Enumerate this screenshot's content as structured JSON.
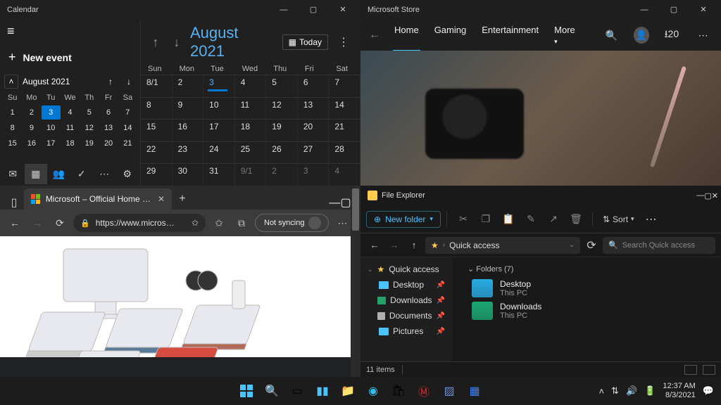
{
  "calendar": {
    "title": "Calendar",
    "new_event": "New event",
    "mini_month": "August 2021",
    "mini_days": [
      "Su",
      "Mo",
      "Tu",
      "We",
      "Th",
      "Fr",
      "Sa"
    ],
    "mini_cells": [
      "1",
      "2",
      "3",
      "4",
      "5",
      "6",
      "7",
      "8",
      "9",
      "10",
      "11",
      "12",
      "13",
      "14",
      "15",
      "16",
      "17",
      "18",
      "19",
      "20",
      "21"
    ],
    "mini_selected_index": 2,
    "big_month": "August 2021",
    "today_label": "Today",
    "big_days": [
      "Sun",
      "Mon",
      "Tue",
      "Wed",
      "Thu",
      "Fri",
      "Sat"
    ],
    "big_cells": [
      {
        "t": "8/1"
      },
      {
        "t": "2"
      },
      {
        "t": "3",
        "today": true
      },
      {
        "t": "4"
      },
      {
        "t": "5"
      },
      {
        "t": "6"
      },
      {
        "t": "7"
      },
      {
        "t": "8"
      },
      {
        "t": "9"
      },
      {
        "t": "10"
      },
      {
        "t": "11"
      },
      {
        "t": "12"
      },
      {
        "t": "13"
      },
      {
        "t": "14"
      },
      {
        "t": "15"
      },
      {
        "t": "16"
      },
      {
        "t": "17"
      },
      {
        "t": "18"
      },
      {
        "t": "19"
      },
      {
        "t": "20"
      },
      {
        "t": "21"
      },
      {
        "t": "22"
      },
      {
        "t": "23"
      },
      {
        "t": "24"
      },
      {
        "t": "25"
      },
      {
        "t": "26"
      },
      {
        "t": "27"
      },
      {
        "t": "28"
      },
      {
        "t": "29"
      },
      {
        "t": "30"
      },
      {
        "t": "31"
      },
      {
        "t": "9/1",
        "dim": true
      },
      {
        "t": "2",
        "dim": true
      },
      {
        "t": "3",
        "dim": true
      },
      {
        "t": "4",
        "dim": true
      }
    ]
  },
  "store": {
    "title": "Microsoft Store",
    "tabs": [
      "Home",
      "Gaming",
      "Entertainment",
      "More"
    ],
    "active_tab": 0,
    "downloads": "20"
  },
  "edge": {
    "tab_title": "Microsoft – Official Home Page",
    "url": "https://www.micros…",
    "sync_label": "Not syncing"
  },
  "explorer": {
    "title": "File Explorer",
    "new_folder": "New folder",
    "sort": "Sort",
    "path": "Quick access",
    "search_placeholder": "Search Quick access",
    "quick_access": "Quick access",
    "side_items": [
      {
        "label": "Desktop",
        "color": "#4cc2ff"
      },
      {
        "label": "Downloads",
        "color": "#26a069"
      },
      {
        "label": "Documents",
        "color": "#b0b0b0"
      },
      {
        "label": "Pictures",
        "color": "#4cc2ff"
      }
    ],
    "folders_header": "Folders (7)",
    "items": [
      {
        "name": "Desktop",
        "sub": "This PC",
        "color": "#29abe2"
      },
      {
        "name": "Downloads",
        "sub": "This PC",
        "color": "#1aa772"
      }
    ],
    "status": "11 items"
  },
  "taskbar": {
    "time": "12:37 AM",
    "date": "8/3/2021"
  }
}
